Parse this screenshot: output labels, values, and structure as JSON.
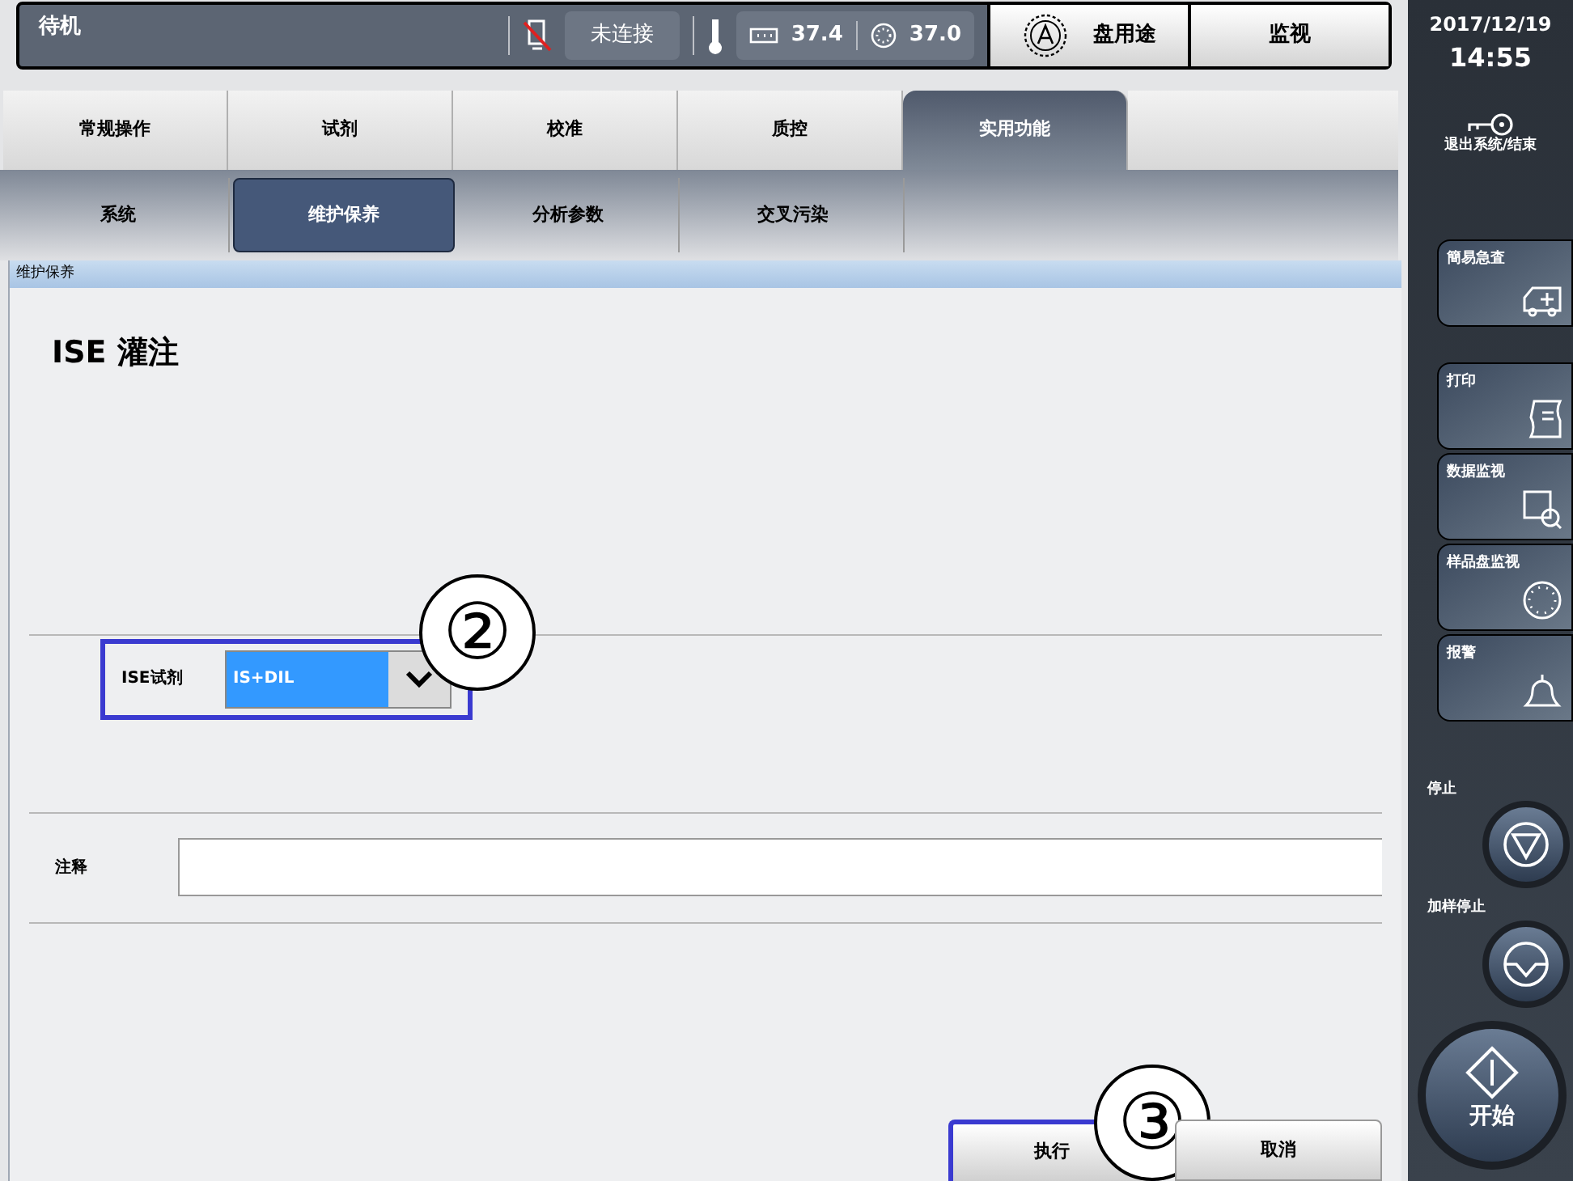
{
  "status_bar": {
    "mode": "待机",
    "connection": "未连接",
    "temp_1": "37.4",
    "temp_2": "37.0"
  },
  "top_buttons": [
    {
      "label": "盘用途",
      "kind": "disk"
    },
    {
      "label": "监视",
      "kind": "plain"
    }
  ],
  "tabs": [
    {
      "label": "常规操作",
      "selected": false
    },
    {
      "label": "试剂",
      "selected": false
    },
    {
      "label": "校准",
      "selected": false
    },
    {
      "label": "质控",
      "selected": false
    },
    {
      "label": "实用功能",
      "selected": true
    }
  ],
  "subtabs": [
    {
      "label": "系统",
      "selected": false
    },
    {
      "label": "维护保养",
      "selected": true
    },
    {
      "label": "分析参数",
      "selected": false
    },
    {
      "label": "交叉污染",
      "selected": false
    }
  ],
  "panel": {
    "header": "维护保养",
    "title": "ISE 灌注",
    "reagent": {
      "label": "ISE试剂",
      "value": "IS+DIL",
      "highlighted": true,
      "callout": "②"
    },
    "comment": {
      "label": "注释"
    }
  },
  "actions": [
    {
      "label": "执行",
      "highlighted": true,
      "callout": "③"
    },
    {
      "label": "取消",
      "highlighted": false
    }
  ],
  "sidebar": {
    "date": "2017/12/19",
    "time": "14:55",
    "logout": "退出系统/结束",
    "quick_button": {
      "label": "簡易急査",
      "kind": "ambulance"
    },
    "buttons": [
      {
        "label": "打印",
        "kind": "print"
      },
      {
        "label": "数据监视",
        "kind": "data"
      },
      {
        "label": "样品盘监视",
        "kind": "disk"
      },
      {
        "label": "报警",
        "kind": "alarm"
      }
    ],
    "controls": [
      {
        "label": "停止",
        "kind": "stop"
      },
      {
        "label": "加样停止",
        "kind": "pause"
      }
    ],
    "start": "开始"
  }
}
